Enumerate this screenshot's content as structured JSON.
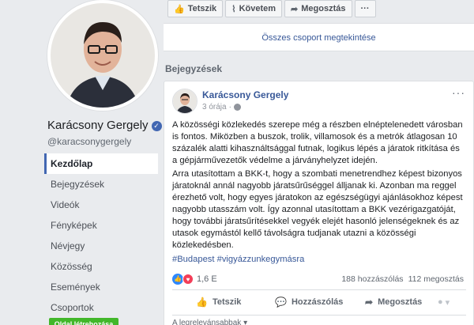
{
  "profile": {
    "name": "Karácsony Gergely",
    "verified_glyph": "✓",
    "handle": "@karacsonygergely"
  },
  "nav": [
    {
      "label": "Kezdőlap",
      "active": true
    },
    {
      "label": "Bejegyzések"
    },
    {
      "label": "Videók"
    },
    {
      "label": "Fényképek"
    },
    {
      "label": "Névjegy"
    },
    {
      "label": "Közösség"
    },
    {
      "label": "Események"
    },
    {
      "label": "Csoportok"
    }
  ],
  "create_page_button": "Oldal létrehozása",
  "action_bar": {
    "like": "Tetszik",
    "follow": "Követem",
    "share": "Megosztás",
    "more": "···"
  },
  "groups": {
    "see_all": "Összes csoport megtekintése"
  },
  "section_title": "Bejegyzések",
  "post": {
    "author": "Karácsony Gergely",
    "time": "3 órája",
    "more": "···",
    "paragraph1": "A közösségi közlekedés szerepe még a részben elnéptelenedett városban is fontos. Miközben a buszok, trolik, villamosok és a metrók átlagosan 10 százalék alatti kihasználtsággal futnak, logikus lépés a járatok ritkítása és a gépjárművezetők védelme a járványhelyzet idején.",
    "paragraph2": "Arra utasítottam a BKK-t, hogy a szombati menetrendhez képest bizonyos járatoknál annál nagyobb járatsűrűséggel álljanak ki. Azonban ma reggel érezhető volt, hogy egyes járatokon az egészségügyi ajánlásokhoz képest nagyobb utasszám volt. Így azonnal utasítottam a BKK vezérigazgatóját, hogy további járatsűrítésekkel vegyék elejét hasonló jelenségeknek és az utasok egymástól kellő távolságra tudjanak utazni a közösségi közlekedésben.",
    "hashtags": "#Budapest #vigyázzunkegymásra",
    "reactions_count": "1,6 E",
    "comments_count": "188 hozzászólás",
    "shares_count": "112 megosztás",
    "actions": {
      "like": "Tetszik",
      "comment": "Hozzászólás",
      "share": "Megosztás"
    },
    "comment_hint": "A legrelevánsabbak ▾"
  },
  "colors": {
    "brand": "#4267b2",
    "link": "#385898",
    "green": "#42b72a",
    "background": "#e9ebee"
  },
  "icons": [
    "like-icon",
    "rss-icon",
    "share-icon",
    "globe-icon",
    "comment-icon",
    "heart-icon",
    "verified-icon"
  ]
}
